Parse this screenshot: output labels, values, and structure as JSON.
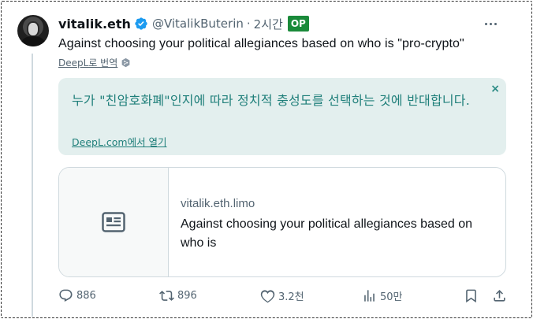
{
  "tweet": {
    "display_name": "vitalik.eth",
    "handle": "@VitalikButerin",
    "separator": "·",
    "time": "2시간",
    "op_badge": "OP",
    "text": "Against choosing your political allegiances based on who is \"pro-crypto\"",
    "translate_link": "DeepL로 번역"
  },
  "translation": {
    "text": "누가 \"친암호화폐\"인지에 따라 정치적 충성도를 선택하는 것에 반대합니다.",
    "close": "×",
    "open_link": "DeepL.com에서 열기"
  },
  "card": {
    "domain": "vitalik.eth.limo",
    "title": "Against choosing your political allegiances based on who is"
  },
  "actions": {
    "replies": "886",
    "reposts": "896",
    "likes": "3.2천",
    "views": "50만"
  },
  "colors": {
    "translation_bg": "#e3efee",
    "translation_text": "#1f7f7a",
    "op_badge": "#1a8a3a",
    "verified": "#1d9bf0"
  },
  "icons": [
    "more-icon",
    "verified-icon",
    "deepl-icon",
    "article-icon",
    "reply-icon",
    "repost-icon",
    "like-icon",
    "views-icon",
    "bookmark-icon",
    "share-icon"
  ]
}
